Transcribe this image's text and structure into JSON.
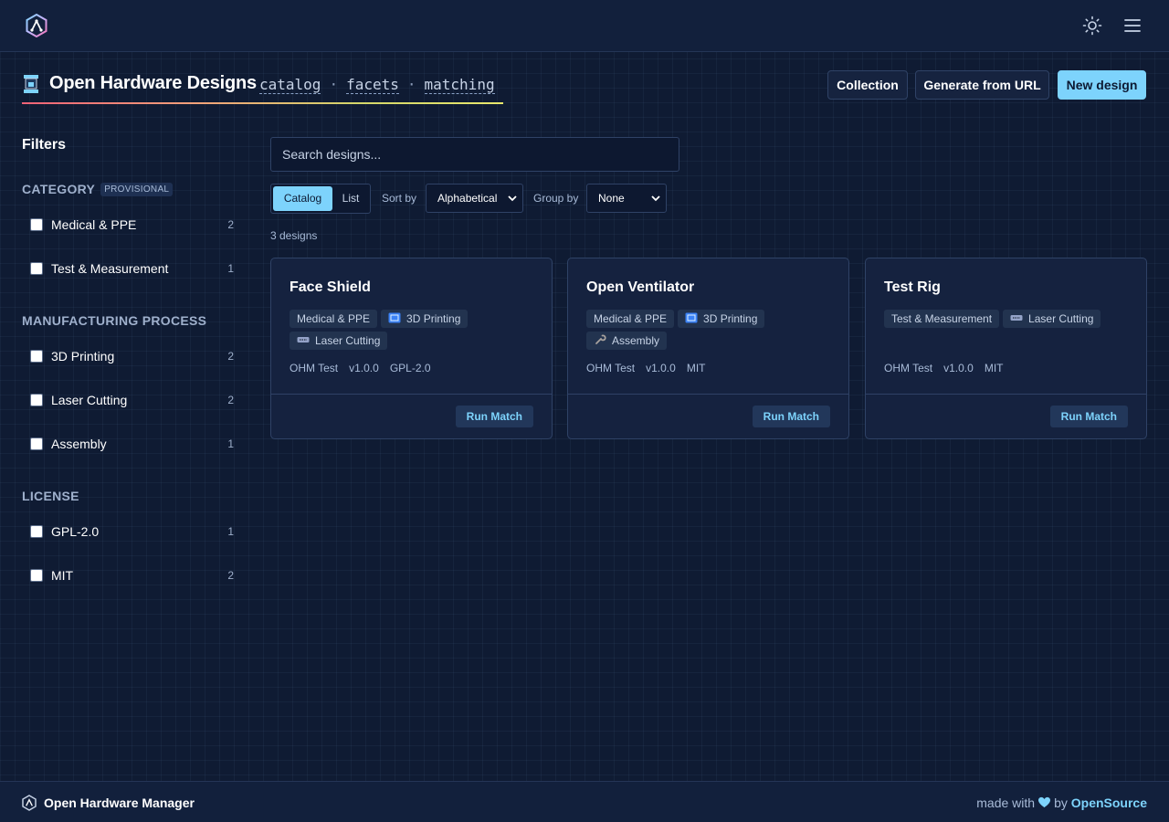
{
  "topbar": {
    "logo_icon": "app-logo-icon",
    "theme_icon": "sun-icon",
    "menu_icon": "hamburger-menu-icon"
  },
  "header": {
    "title": "Open Hardware Designs",
    "title_icon": "printer-icon",
    "nav": [
      "catalog",
      "facets",
      "matching"
    ],
    "nav_separator": "·",
    "buttons": {
      "collection": "Collection",
      "generate": "Generate from URL",
      "new_design": "New design"
    }
  },
  "filters": {
    "heading": "Filters",
    "category": {
      "title": "CATEGORY",
      "badge": "PROVISIONAL",
      "items": [
        {
          "label": "Medical & PPE",
          "count": "2"
        },
        {
          "label": "Test & Measurement",
          "count": "1"
        }
      ]
    },
    "process": {
      "title": "MANUFACTURING PROCESS",
      "items": [
        {
          "label": "3D Printing",
          "count": "2"
        },
        {
          "label": "Laser Cutting",
          "count": "2"
        },
        {
          "label": "Assembly",
          "count": "1"
        }
      ]
    },
    "license": {
      "title": "LICENSE",
      "items": [
        {
          "label": "GPL-2.0",
          "count": "1"
        },
        {
          "label": "MIT",
          "count": "2"
        }
      ]
    }
  },
  "main": {
    "search_placeholder": "Search designs...",
    "view_options": [
      "Catalog",
      "List"
    ],
    "active_view": "Catalog",
    "sort_label": "Sort by",
    "sort_value": "Alphabetical",
    "group_label": "Group by",
    "group_value": "None",
    "count_text": "3 designs",
    "run_match_label": "Run Match",
    "cards": [
      {
        "title": "Face Shield",
        "tags": [
          "Medical & PPE",
          "3D Printing",
          "Laser Cutting"
        ],
        "meta": [
          "OHM Test",
          "v1.0.0",
          "GPL-2.0"
        ]
      },
      {
        "title": "Open Ventilator",
        "tags": [
          "Medical & PPE",
          "3D Printing",
          "Assembly"
        ],
        "meta": [
          "OHM Test",
          "v1.0.0",
          "MIT"
        ]
      },
      {
        "title": "Test Rig",
        "tags": [
          "Test & Measurement",
          "Laser Cutting"
        ],
        "meta": [
          "OHM Test",
          "v1.0.0",
          "MIT"
        ]
      }
    ]
  },
  "footer": {
    "app_name": "Open Hardware Manager",
    "made_with": "made with",
    "by": "by",
    "org": "OpenSource"
  },
  "colors": {
    "background": "#0f1b33",
    "accent": "#7dd3fc",
    "card": "#15223f"
  }
}
